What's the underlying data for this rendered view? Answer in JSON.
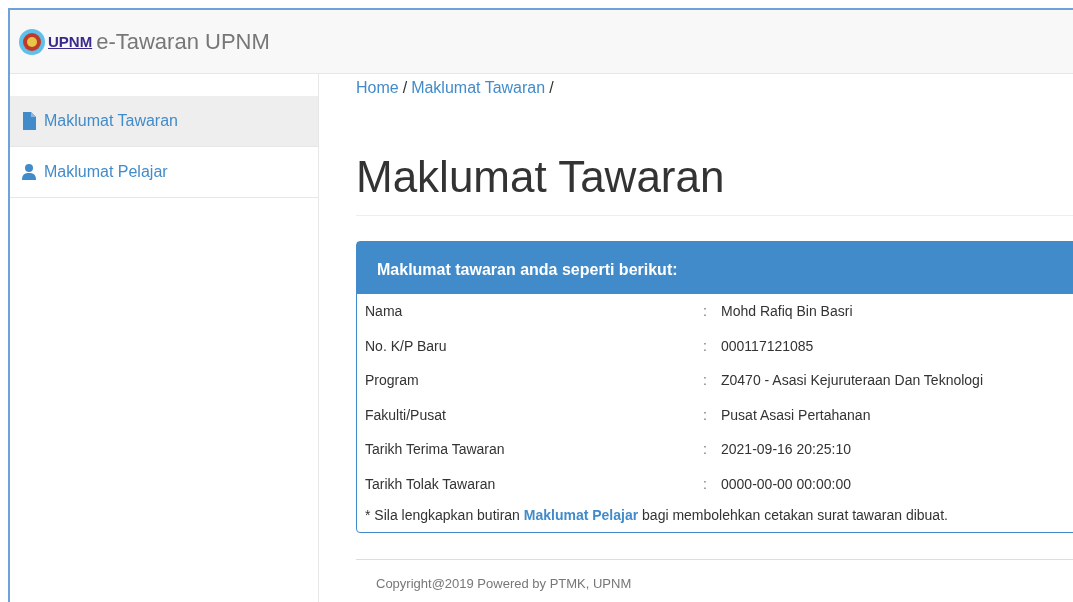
{
  "navbar": {
    "logo_text": "UPNM",
    "title": "e-Tawaran UPNM"
  },
  "sidebar": {
    "items": [
      {
        "label": "Maklumat Tawaran",
        "kind": "file",
        "selected": true
      },
      {
        "label": "Maklumat Pelajar",
        "kind": "user",
        "selected": false
      }
    ]
  },
  "breadcrumb": [
    {
      "label": "Home",
      "separator": "/"
    },
    {
      "label": "Maklumat Tawaran",
      "separator": "/"
    }
  ],
  "heading": "Maklumat Tawaran",
  "card": {
    "title": "Maklumat tawaran anda seperti berikut:",
    "rows": [
      {
        "label": "Nama",
        "colon": ":",
        "value": "Mohd Rafiq Bin Basri"
      },
      {
        "label": "No. K/P Baru",
        "colon": ":",
        "value": "000117121085"
      },
      {
        "label": "Program",
        "colon": ":",
        "value": "Z0470 - Asasi Kejuruteraan Dan Teknologi"
      },
      {
        "label": "Fakulti/Pusat",
        "colon": ":",
        "value": "Pusat Asasi Pertahanan"
      },
      {
        "label": "Tarikh Terima Tawaran",
        "colon": ":",
        "value": "2021-09-16 20:25:10"
      },
      {
        "label": "Tarikh Tolak Tawaran",
        "colon": ":",
        "value": "0000-00-00 00:00:00"
      }
    ],
    "note": {
      "before": "* Sila lengkapkan butiran",
      "link": "Maklumat Pelajar",
      "after": "bagi membolehkan cetakan surat tawaran dibuat."
    }
  },
  "footer": "Copyright@2019 Powered by PTMK, UPNM"
}
